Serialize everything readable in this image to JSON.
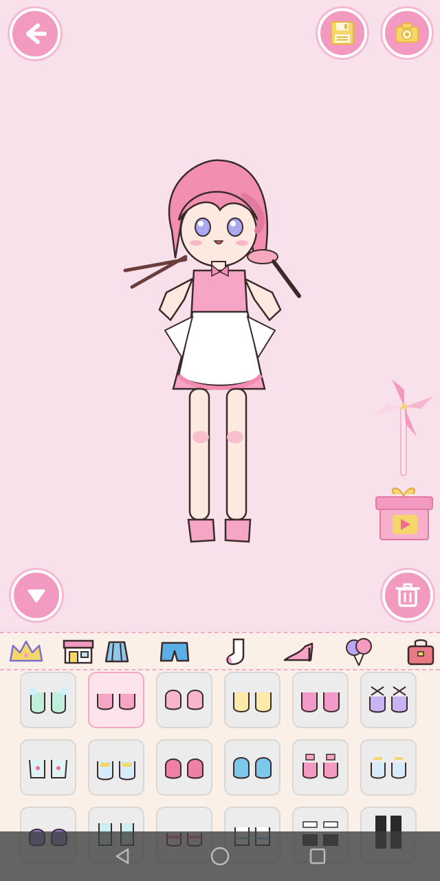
{
  "toolbar": {
    "back_icon": "arrow-left-icon",
    "save_icon": "floppy-disk-icon",
    "camera_icon": "camera-icon"
  },
  "stage": {
    "collapse_icon": "triangle-down-icon",
    "delete_icon": "trash-icon",
    "pinwheel_icon": "pinwheel-icon",
    "gift_video_icon": "gift-video-icon"
  },
  "categories": [
    {
      "name": "crown",
      "icon": "crown-icon"
    },
    {
      "name": "shop",
      "icon": "shop-icon"
    },
    {
      "name": "skirt",
      "icon": "skirt-icon"
    },
    {
      "name": "shorts",
      "icon": "shorts-icon"
    },
    {
      "name": "socks",
      "icon": "sock-icon"
    },
    {
      "name": "heels",
      "icon": "high-heel-icon"
    },
    {
      "name": "balloons",
      "icon": "balloons-icon"
    },
    {
      "name": "bag",
      "icon": "bag-icon"
    }
  ],
  "colors": {
    "bg": "#f8e1ea",
    "accent": "#f39ac0",
    "gold": "#f5d66a"
  },
  "navbar": {
    "back_icon": "nav-back-icon",
    "home_icon": "nav-home-icon",
    "recents_icon": "nav-recents-icon"
  }
}
